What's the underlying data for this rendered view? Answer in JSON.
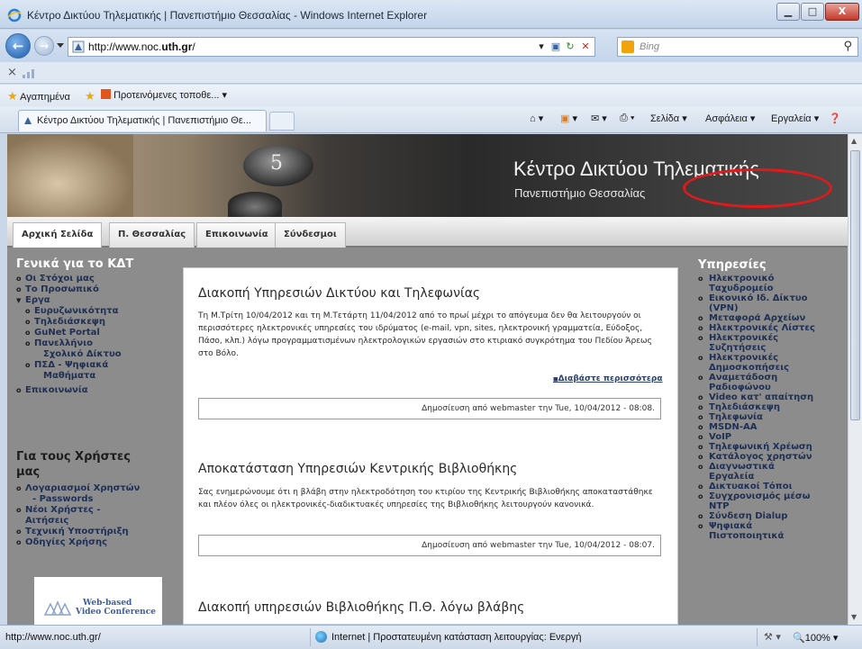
{
  "window": {
    "title": "Κέντρο Δικτύου Τηλεματικής | Πανεπιστήμιο Θεσσαλίας - Windows Internet Explorer",
    "minimize": "▁",
    "maximize": "□",
    "close": "X"
  },
  "address": {
    "url_prefix": "http://www.noc.",
    "url_domain": "uth.gr",
    "url_suffix": "/"
  },
  "search": {
    "placeholder": "Bing"
  },
  "favorites": {
    "label": "Αγαπημένα",
    "suggested": "Προτεινόμενες τοποθε..."
  },
  "tab": {
    "label": "Κέντρο Δικτύου Τηλεματικής | Πανεπιστήμιο Θε..."
  },
  "commandbar": {
    "page": "Σελίδα",
    "safety": "Ασφάλεια",
    "tools": "Εργαλεία"
  },
  "site": {
    "title": "Κέντρο Δικτύου Τηλεματικής",
    "subtitle": "Πανεπιστήμιο Θεσσαλίας",
    "nav": [
      "Αρχική Σελίδα",
      "Π. Θεσσαλίας",
      "Επικοινωνία",
      "Σύνδεσμοι"
    ],
    "left": {
      "section1": "Γενικά για το ΚΔΤ",
      "items1": [
        "Οι Στόχοι μας",
        "Το Προσωπικό",
        "Εργα"
      ],
      "sub1": [
        "Ευρυζωνικότητα",
        "Τηλεδιάσκεψη",
        "GuNet Portal"
      ],
      "sub1_multi": [
        [
          "Πανελλήνιο",
          "Σχολικό Δίκτυο"
        ],
        [
          "ΠΣΔ - Ψηφιακά",
          "Μαθήματα"
        ]
      ],
      "item_contact": "Επικοινωνία",
      "section2": [
        "Για τους Χρήστες",
        "μας"
      ],
      "items2": [
        [
          "Λογαριασμοί Χρηστών",
          "- Passwords"
        ],
        [
          "Νέοι Χρήστες -",
          "Αιτήσεις"
        ],
        [
          "Τεχνική Υποστήριξη"
        ],
        [
          "Οδηγίες Χρήσης"
        ]
      ],
      "promo": [
        "Web-based",
        "Video Conference"
      ]
    },
    "articles": [
      {
        "title": "Διακοπή Υπηρεσιών Δικτύου και Τηλεφωνίας",
        "body": "Τη Μ.Τρίτη 10/04/2012 και τη Μ.Τετάρτη 11/04/2012 από το πρωί μέχρι το απόγευμα δεν θα λειτουργούν οι περισσότερες ηλεκτρονικές υπηρεσίες του ιδρύματος (e-mail, vpn, sites, ηλεκτρονική γραμματεία, Εύδοξος, Πάσο, κλπ.) λόγω προγραμματισμένων ηλεκτρολογικών εργασιών στο κτιριακό συγκρότημα του Πεδίου Άρεως στο Βόλο.",
        "readmore": "Διαβάστε περισσότερα",
        "published": "Δημοσίευση από webmaster την Tue, 10/04/2012 - 08:08."
      },
      {
        "title": "Αποκατάσταση Υπηρεσιών Κεντρικής Βιβλιοθήκης",
        "body": "Σας ενημερώνουμε ότι η βλάβη στην ηλεκτροδότηση του κτιρίου της Κεντρικής Βιβλιοθήκης αποκαταστάθηκε και πλέον όλες οι ηλεκτρονικές-διαδικτυακές υπηρεσίες της Βιβλιοθήκης λειτουργούν κανονικά.",
        "published": "Δημοσίευση από webmaster την Tue, 10/04/2012 - 08:07."
      },
      {
        "title": "Διακοπή υπηρεσιών Βιβλιοθήκης Π.Θ. λόγω βλάβης"
      }
    ],
    "right": {
      "section": "Υπηρεσίες",
      "items": [
        [
          "Ηλεκτρονικό",
          "Ταχυδρομείο"
        ],
        [
          "Εικονικό Ιδ. Δίκτυο",
          "(VPN)"
        ],
        [
          "Μεταφορά Αρχείων"
        ],
        [
          "Ηλεκτρονικές Λίστες"
        ],
        [
          "Ηλεκτρονικές",
          "Συζητήσεις"
        ],
        [
          "Ηλεκτρονικές",
          "Δημοσκοπήσεις"
        ],
        [
          "Αναμετάδοση",
          "Ραδιοφώνου"
        ],
        [
          "Video κατ' απαίτηση"
        ],
        [
          "Τηλεδιάσκεψη"
        ],
        [
          "Τηλεφωνία"
        ],
        [
          "MSDN-AA"
        ],
        [
          "VoIP"
        ],
        [
          "Τηλεφωνική Χρέωση"
        ],
        [
          "Κατάλογος χρηστών"
        ],
        [
          "Διαγνωστικά",
          "Εργαλεία"
        ],
        [
          "Δικτυακοί Τόποι"
        ],
        [
          "Συγχρονισμός μέσω",
          "NTP"
        ],
        [
          "Σύνδεση Dialup"
        ],
        [
          "Ψηφιακά",
          "Πιστοποιητικά"
        ]
      ]
    }
  },
  "status": {
    "url": "http://www.noc.uth.gr/",
    "zone": "Internet | Προστατευμένη κατάσταση λειτουργίας: Ενεργή",
    "zoom": "100%"
  }
}
